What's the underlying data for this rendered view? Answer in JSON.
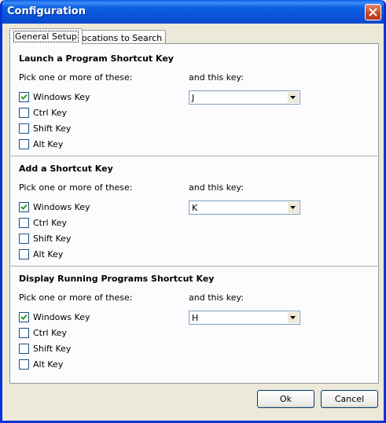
{
  "window": {
    "title": "Configuration"
  },
  "tabs": [
    {
      "label": "General Setup",
      "active": true
    },
    {
      "label": "Locations to Search",
      "active": false
    }
  ],
  "sections": [
    {
      "title": "Launch a Program Shortcut Key",
      "pick_label": "Pick one or more of these:",
      "key_label": "and this key:",
      "checkboxes": [
        {
          "label": "Windows Key",
          "checked": true
        },
        {
          "label": "Ctrl Key",
          "checked": false
        },
        {
          "label": "Shift Key",
          "checked": false
        },
        {
          "label": "Alt Key",
          "checked": false
        }
      ],
      "key_value": "J"
    },
    {
      "title": "Add a Shortcut Key",
      "pick_label": "Pick one or more of these:",
      "key_label": "and this key:",
      "checkboxes": [
        {
          "label": "Windows Key",
          "checked": true
        },
        {
          "label": "Ctrl Key",
          "checked": false
        },
        {
          "label": "Shift Key",
          "checked": false
        },
        {
          "label": "Alt Key",
          "checked": false
        }
      ],
      "key_value": "K"
    },
    {
      "title": "Display Running Programs Shortcut Key",
      "pick_label": "Pick one or more of these:",
      "key_label": "and this key:",
      "checkboxes": [
        {
          "label": "Windows Key",
          "checked": true
        },
        {
          "label": "Ctrl Key",
          "checked": false
        },
        {
          "label": "Shift Key",
          "checked": false
        },
        {
          "label": "Alt Key",
          "checked": false
        }
      ],
      "key_value": "H"
    }
  ],
  "buttons": {
    "ok_label": "Ok",
    "cancel_label": "Cancel"
  },
  "colors": {
    "title_bar": "#0a52d8",
    "close_button": "#c94520",
    "panel_bg": "#fcfcfe",
    "dialog_bg": "#ece9d8"
  },
  "icons": {
    "close": "close-icon",
    "dropdown": "chevron-down-icon",
    "check": "checkmark-icon"
  }
}
